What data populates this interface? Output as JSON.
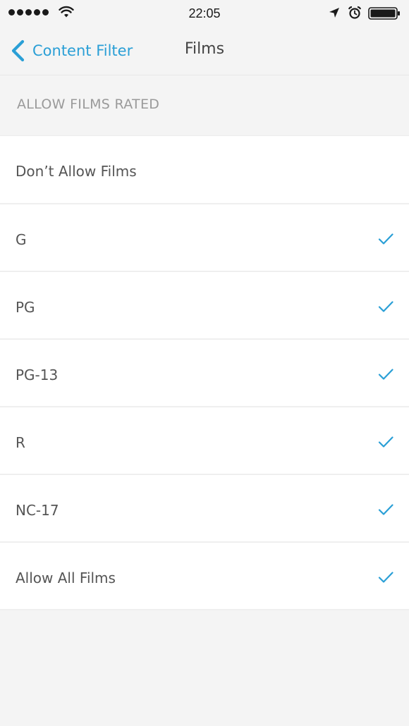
{
  "status_bar": {
    "time": "22:05",
    "icons": [
      "signal-dots-icon",
      "wifi-icon",
      "location-arrow-icon",
      "alarm-clock-icon",
      "battery-icon"
    ]
  },
  "nav": {
    "back_label": "Content Filter",
    "title": "Films"
  },
  "section": {
    "header": "ALLOW FILMS RATED"
  },
  "ratings": [
    {
      "label": "Don’t Allow Films",
      "checked": false
    },
    {
      "label": "G",
      "checked": true
    },
    {
      "label": "PG",
      "checked": true
    },
    {
      "label": "PG-13",
      "checked": true
    },
    {
      "label": "R",
      "checked": true
    },
    {
      "label": "NC-17",
      "checked": true
    },
    {
      "label": "Allow All Films",
      "checked": true
    }
  ],
  "colors": {
    "accent": "#2a9fd6",
    "background": "#f4f4f4",
    "row_background": "#ffffff",
    "section_text": "#9a9a9a"
  }
}
